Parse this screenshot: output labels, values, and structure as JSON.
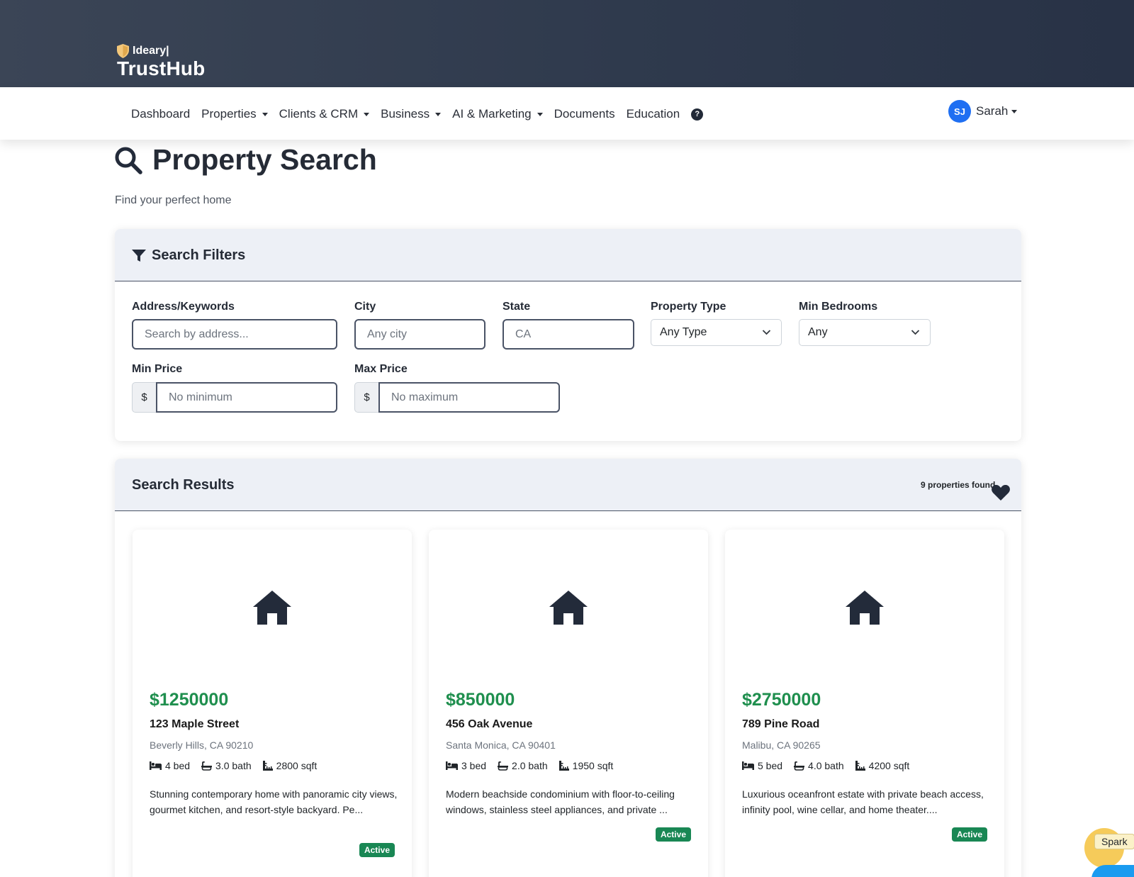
{
  "brand": {
    "top": "Ideary|",
    "main": "TrustHub"
  },
  "nav": {
    "items": [
      {
        "label": "Dashboard",
        "dropdown": false
      },
      {
        "label": "Properties",
        "dropdown": true
      },
      {
        "label": "Clients & CRM",
        "dropdown": true
      },
      {
        "label": "Business",
        "dropdown": true
      },
      {
        "label": "AI & Marketing",
        "dropdown": true
      },
      {
        "label": "Documents",
        "dropdown": false
      },
      {
        "label": "Education",
        "dropdown": false
      }
    ],
    "help_symbol": "?",
    "user": {
      "initials": "SJ",
      "name": "Sarah"
    }
  },
  "page": {
    "title": "Property Search",
    "subtitle": "Find your perfect home"
  },
  "filters": {
    "title": "Search Filters",
    "address": {
      "label": "Address/Keywords",
      "placeholder": "Search by address..."
    },
    "city": {
      "label": "City",
      "placeholder": "Any city"
    },
    "state": {
      "label": "State",
      "value": "CA"
    },
    "property_type": {
      "label": "Property Type",
      "value": "Any Type"
    },
    "min_bedrooms": {
      "label": "Min Bedrooms",
      "value": "Any"
    },
    "min_price": {
      "label": "Min Price",
      "addon": "$",
      "placeholder": "No minimum"
    },
    "max_price": {
      "label": "Max Price",
      "addon": "$",
      "placeholder": "No maximum"
    }
  },
  "results": {
    "title": "Search Results",
    "count": "9 properties found",
    "properties": [
      {
        "price": "$1250000",
        "address": "123 Maple Street",
        "city": "Beverly Hills, CA 90210",
        "beds": "4 bed",
        "baths": "3.0 bath",
        "sqft": "2800 sqft",
        "description": "Stunning contemporary home with panoramic city views, gourmet kitchen, and resort-style backyard. Pe...",
        "status": "Active"
      },
      {
        "price": "$850000",
        "address": "456 Oak Avenue",
        "city": "Santa Monica, CA 90401",
        "beds": "3 bed",
        "baths": "2.0 bath",
        "sqft": "1950 sqft",
        "description": "Modern beachside condominium with floor-to-ceiling windows, stainless steel appliances, and private ...",
        "status": "Active"
      },
      {
        "price": "$2750000",
        "address": "789 Pine Road",
        "city": "Malibu, CA 90265",
        "beds": "5 bed",
        "baths": "4.0 bath",
        "sqft": "4200 sqft",
        "description": "Luxurious oceanfront estate with private beach access, infinity pool, wine cellar, and home theater....",
        "status": "Active"
      }
    ]
  },
  "assistant": {
    "label": "Spark"
  },
  "colors": {
    "header": "#2f3a4d",
    "price": "#1f8f4e",
    "badge": "#198754",
    "avatar": "#1f6ff2",
    "icon": "#232b3a"
  },
  "icons": {
    "search": "magnifier-icon",
    "filter": "funnel-icon",
    "home": "house-icon",
    "favorite": "heart-icon",
    "bed": "bed-icon",
    "bath": "bath-icon",
    "sqft": "ruler-icon"
  }
}
